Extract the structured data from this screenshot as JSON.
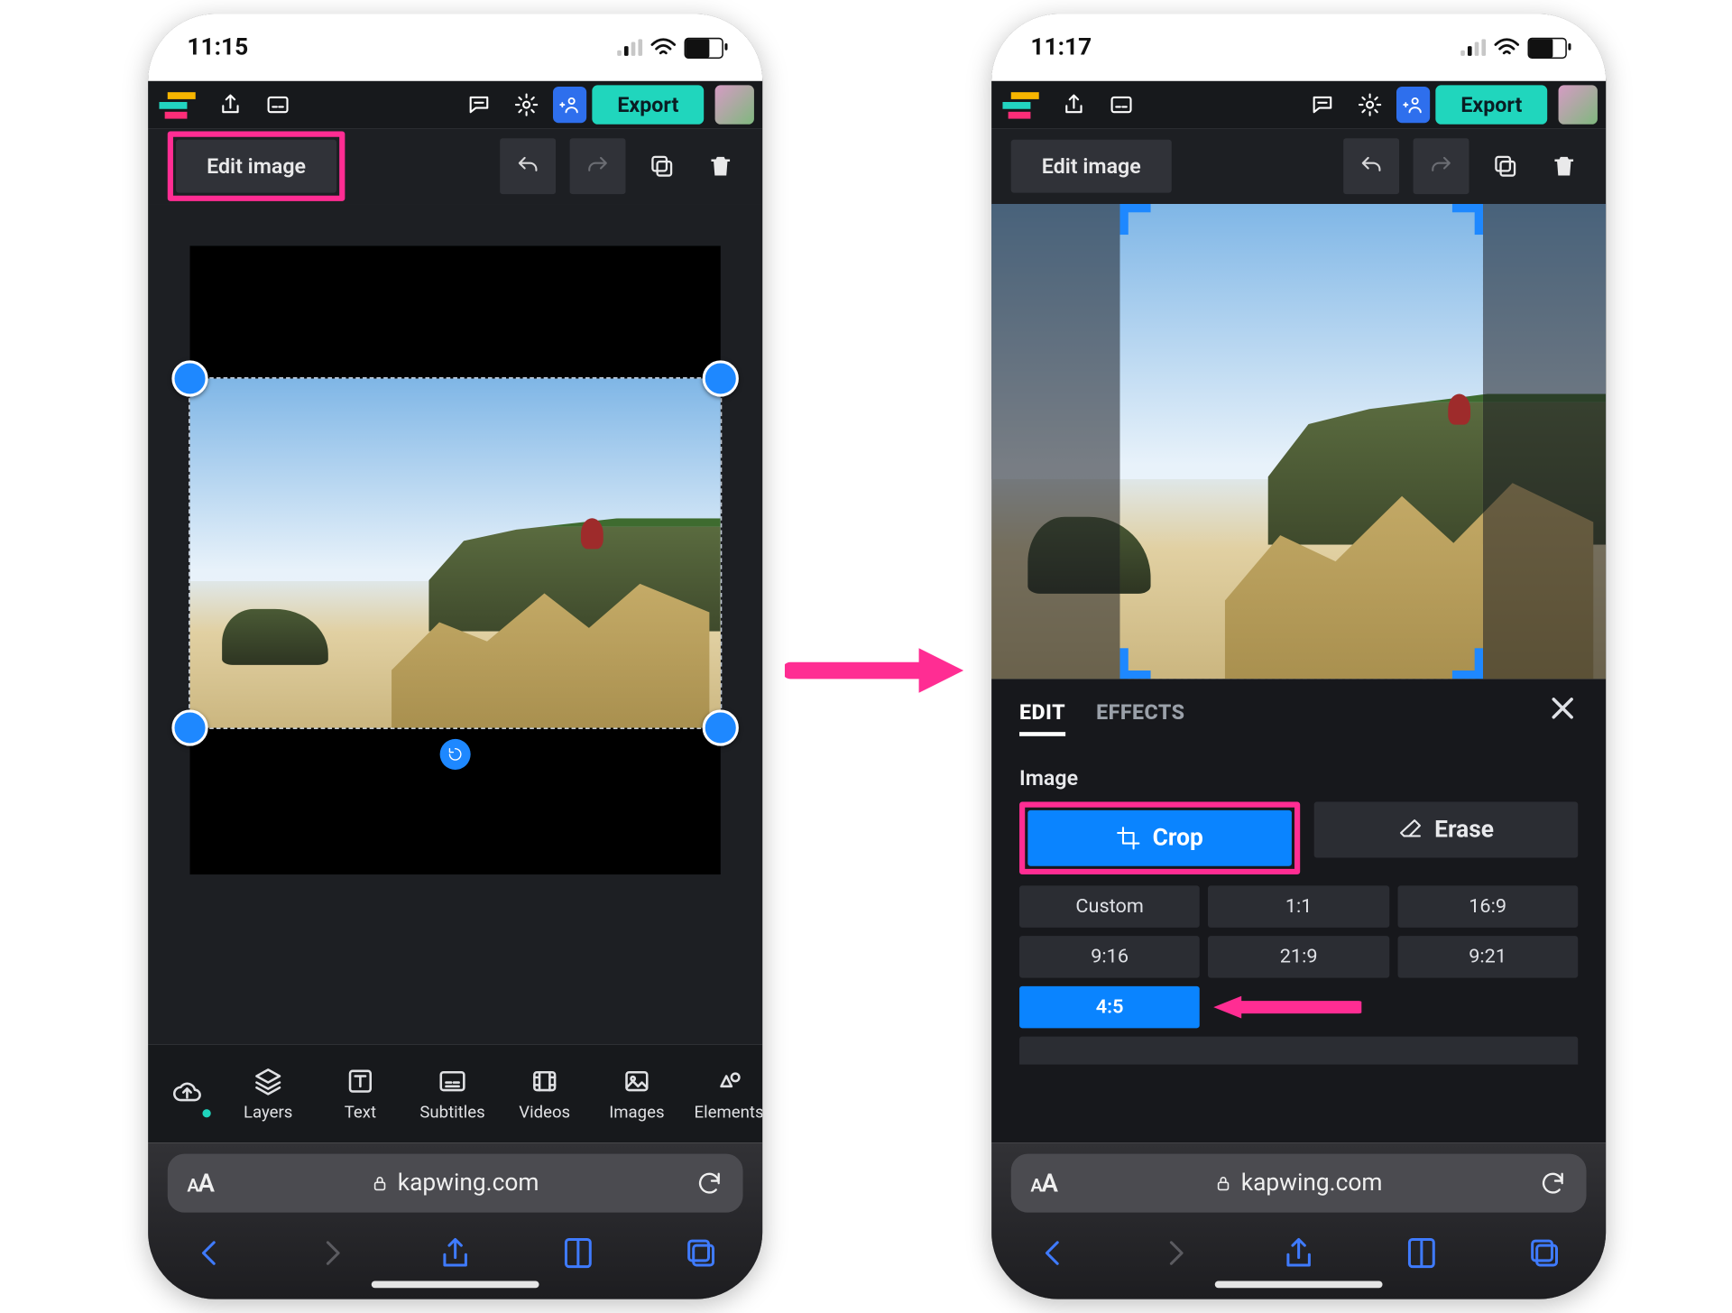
{
  "statusbar": {
    "time_left": "11:15",
    "time_right": "11:17"
  },
  "appbar": {
    "export_label": "Export"
  },
  "toolbar": {
    "edit_image_label": "Edit image"
  },
  "toolstrip": {
    "layers": "Layers",
    "text": "Text",
    "subtitles": "Subtitles",
    "videos": "Videos",
    "images": "Images",
    "elements": "Elements"
  },
  "panel": {
    "tab_edit": "EDIT",
    "tab_effects": "EFFECTS",
    "section_label": "Image",
    "crop_label": "Crop",
    "erase_label": "Erase",
    "ratios": {
      "r1": "Custom",
      "r2": "1:1",
      "r3": "16:9",
      "r4": "9:16",
      "r5": "21:9",
      "r6": "9:21",
      "r7": "4:5"
    }
  },
  "safari": {
    "domain": "kapwing.com"
  }
}
